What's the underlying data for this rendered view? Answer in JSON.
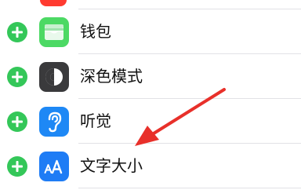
{
  "rows": [
    {
      "label": "钱包",
      "icon": "wallet-icon",
      "icon_color": "#4cd964"
    },
    {
      "label": "深色模式",
      "icon": "dark-mode-icon",
      "icon_color": "#3a3a3c"
    },
    {
      "label": "听觉",
      "icon": "hearing-ear-icon",
      "icon_color": "#1e88f5"
    },
    {
      "label": "文字大小",
      "icon": "text-size-icon",
      "icon_color": "#1e7cf5"
    }
  ],
  "top_row": {
    "icon": "app-icon",
    "icon_color": "#ff3b30"
  },
  "add_button": {
    "icon": "plus-icon",
    "color": "#34c759"
  },
  "annotation": {
    "icon": "arrow-icon",
    "color": "#e8302a"
  }
}
